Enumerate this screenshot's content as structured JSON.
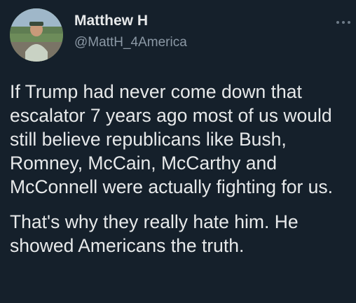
{
  "user": {
    "display_name": "Matthew H",
    "handle": "@MattH_4America"
  },
  "more_icon": "more-horizontal-icon",
  "tweet": {
    "paragraphs": [
      "If Trump had never come down that escalator 7 years ago most of us would still believe republicans like Bush, Romney, McCain, McCarthy and McConnell were actually fighting for us.",
      "That's why they really hate him. He showed Americans the truth."
    ]
  },
  "colors": {
    "background": "#15202b",
    "text_primary": "#e7e9ea",
    "text_secondary": "#8b98a5"
  }
}
